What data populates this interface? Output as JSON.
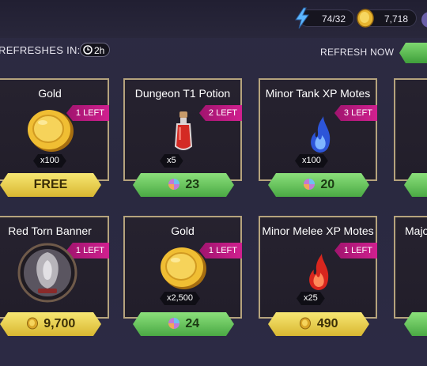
{
  "resources": {
    "energy": "74/32",
    "gold": "7,718"
  },
  "shop": {
    "refresh_label": "REFRESHES IN:",
    "timer": "2h",
    "refresh_now": "REFRESH NOW"
  },
  "cards": [
    {
      "name": "Gold",
      "badge": "1 LEFT",
      "qty": "x100",
      "price": "FREE",
      "price_style": "yellow",
      "currency_icon": ""
    },
    {
      "name": "Dungeon T1 Potion",
      "badge": "2 LEFT",
      "qty": "x5",
      "price": "23",
      "price_style": "green",
      "currency_icon": "gem-icon"
    },
    {
      "name": "Minor Tank XP Motes",
      "badge": "3 LEFT",
      "qty": "x100",
      "price": "20",
      "price_style": "green",
      "currency_icon": "gem-icon"
    },
    {
      "name": "Red Torn Banner",
      "badge": "1 LEFT",
      "qty": "",
      "price": "9,700",
      "price_style": "yellow",
      "currency_icon": "coin-icon"
    },
    {
      "name": "Gold",
      "badge": "1 LEFT",
      "qty": "x2,500",
      "price": "24",
      "price_style": "green",
      "currency_icon": "gem-icon"
    },
    {
      "name": "Minor Melee XP Motes",
      "badge": "1 LEFT",
      "qty": "x25",
      "price": "490",
      "price_style": "yellow",
      "currency_icon": "coin-icon"
    },
    {
      "name": "Majo",
      "badge": "",
      "qty": "",
      "price": "",
      "price_style": "green",
      "currency_icon": ""
    }
  ],
  "colors": {
    "card_border": "#b5a37d",
    "badge": "#c01c80",
    "price_green": "#5fbf55",
    "price_yellow": "#e8cc45"
  }
}
